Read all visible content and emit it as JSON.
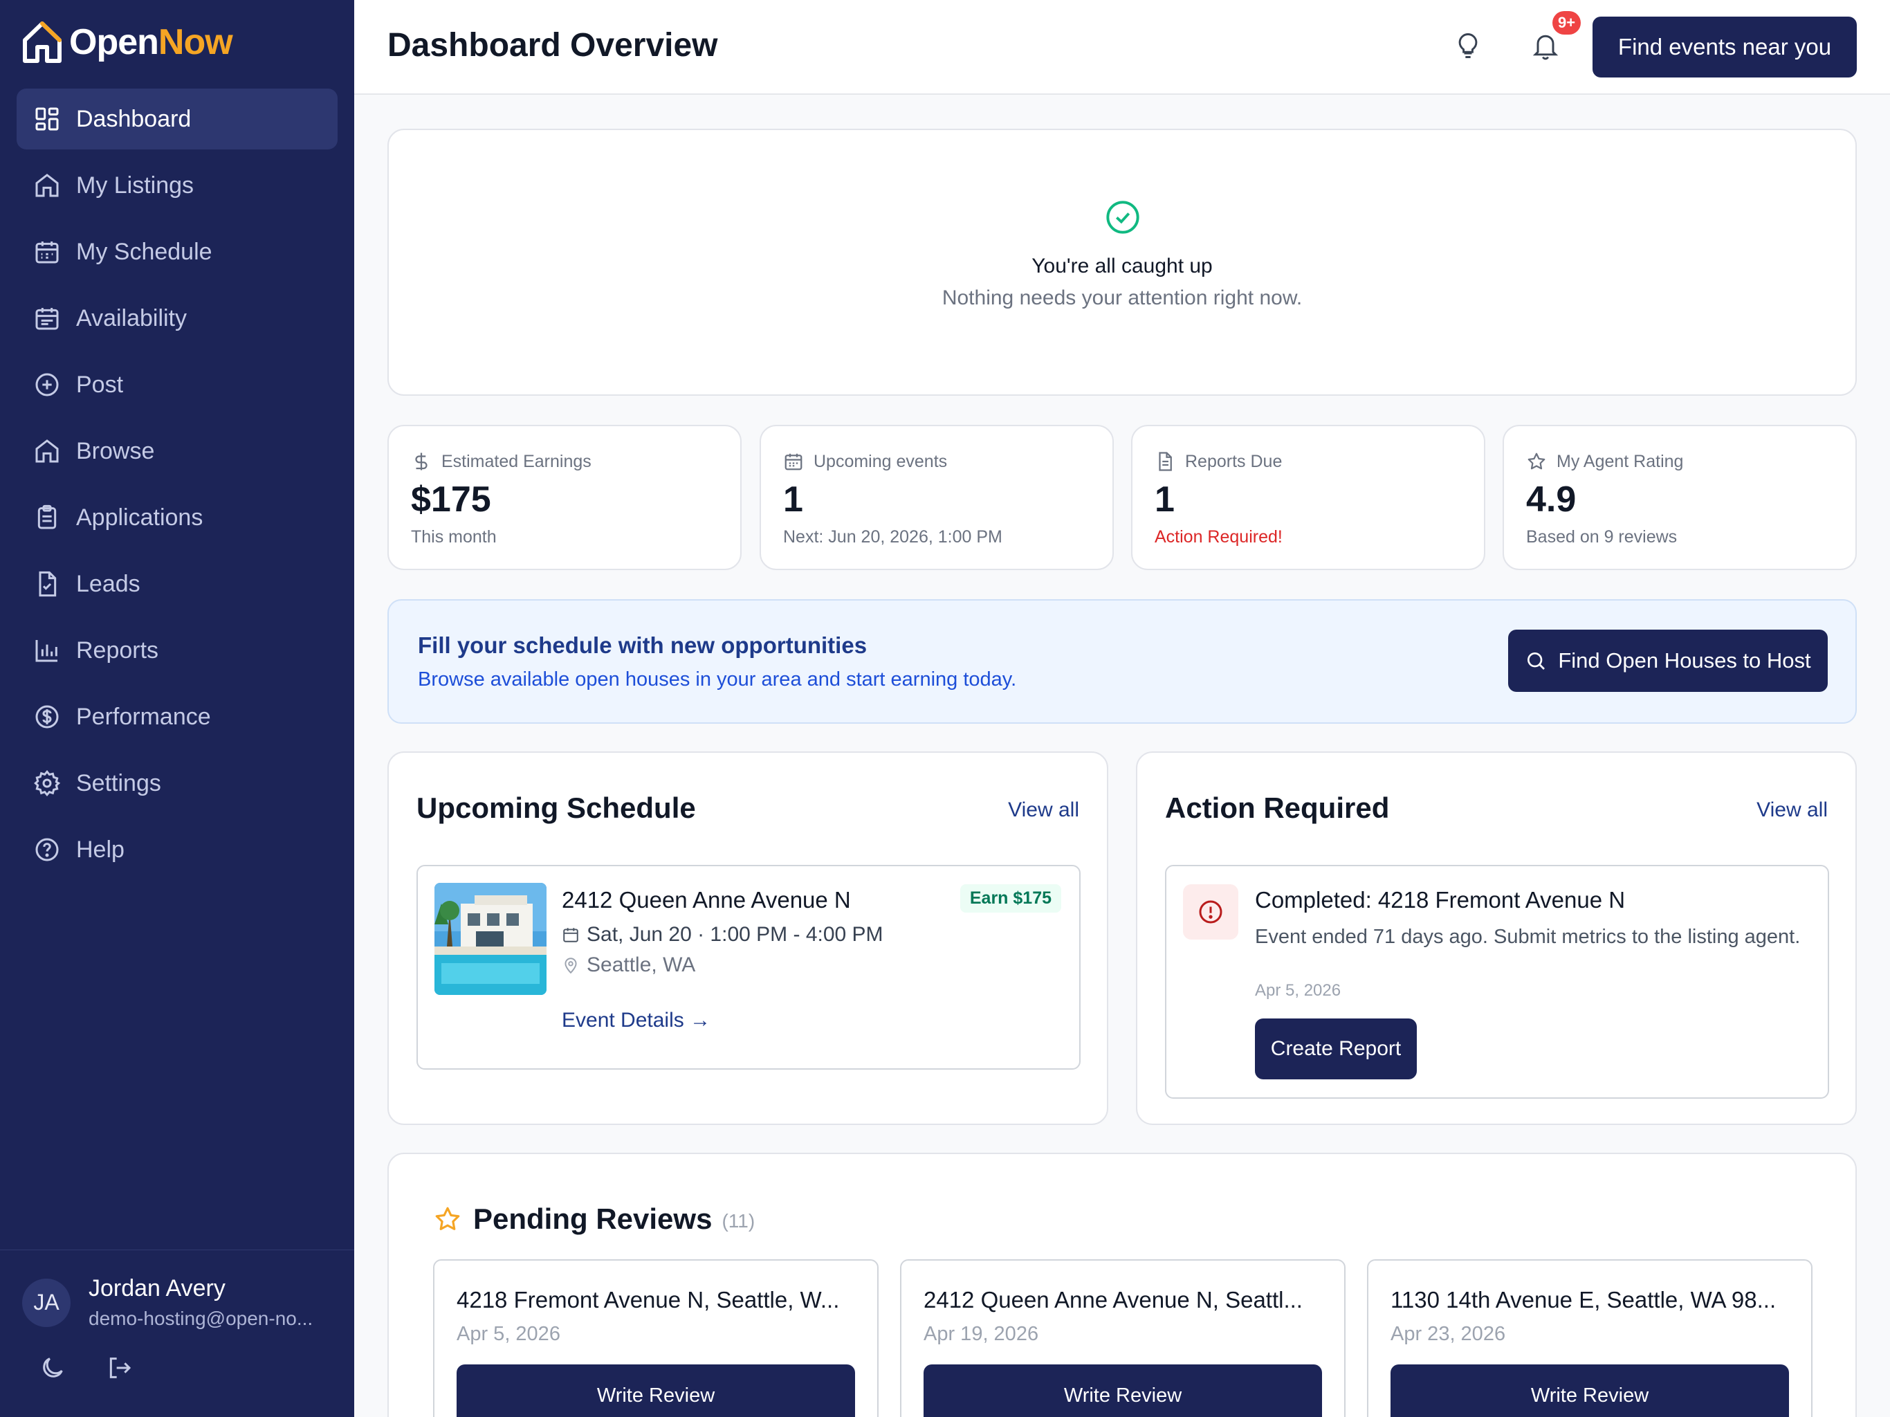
{
  "brand": {
    "open": "Open",
    "now": "Now",
    "accent": "#f5a524",
    "sidebar_bg": "#1c2457"
  },
  "nav": {
    "items": [
      {
        "label": "Dashboard",
        "icon": "grid-icon",
        "active": true
      },
      {
        "label": "My Listings",
        "icon": "home-icon"
      },
      {
        "label": "My Schedule",
        "icon": "calendar-icon"
      },
      {
        "label": "Availability",
        "icon": "calendar-check-icon"
      },
      {
        "label": "Post",
        "icon": "plus-circle-icon"
      },
      {
        "label": "Browse",
        "icon": "home-icon"
      },
      {
        "label": "Applications",
        "icon": "clipboard-icon"
      },
      {
        "label": "Leads",
        "icon": "file-check-icon"
      },
      {
        "label": "Reports",
        "icon": "bar-chart-icon"
      },
      {
        "label": "Performance",
        "icon": "dollar-circle-icon"
      },
      {
        "label": "Settings",
        "icon": "gear-icon"
      },
      {
        "label": "Help",
        "icon": "help-circle-icon"
      }
    ]
  },
  "user": {
    "initials": "JA",
    "name": "Jordan Avery",
    "email": "demo-hosting@open-no..."
  },
  "header": {
    "title": "Dashboard Overview",
    "notification_badge": "9+",
    "find_events_label": "Find events near you"
  },
  "caught_up": {
    "title": "You're all caught up",
    "subtitle": "Nothing needs your attention right now."
  },
  "stats": [
    {
      "label": "Estimated Earnings",
      "value": "$175",
      "sub": "This month",
      "icon": "dollar-icon"
    },
    {
      "label": "Upcoming events",
      "value": "1",
      "sub": "Next: Jun 20, 2026, 1:00 PM",
      "icon": "calendar-icon"
    },
    {
      "label": "Reports Due",
      "value": "1",
      "sub": "Action Required!",
      "icon": "document-icon"
    },
    {
      "label": "My Agent Rating",
      "value": "4.9",
      "sub": "Based on 9 reviews",
      "icon": "star-icon"
    }
  ],
  "promo": {
    "title": "Fill your schedule with new opportunities",
    "subtitle": "Browse available open houses in your area and start earning today.",
    "button": "Find Open Houses to Host"
  },
  "upcoming": {
    "title": "Upcoming Schedule",
    "view_all": "View all",
    "event": {
      "address": "2412 Queen Anne Avenue N",
      "earn": "Earn $175",
      "datetime": "Sat, Jun 20 · 1:00 PM - 4:00 PM",
      "location": "Seattle, WA",
      "link": "Event Details →"
    }
  },
  "action_required": {
    "title": "Action Required",
    "view_all": "View all",
    "item": {
      "title": "Completed: 4218 Fremont Avenue N",
      "description": "Event ended 71 days ago. Submit metrics to the listing agent.",
      "date": "Apr 5, 2026",
      "button": "Create Report"
    }
  },
  "reviews": {
    "title": "Pending Reviews",
    "count": "(11)",
    "items": [
      {
        "address": "4218 Fremont Avenue N, Seattle, W...",
        "date": "Apr 5, 2026",
        "button": "Write Review"
      },
      {
        "address": "2412 Queen Anne Avenue N, Seattl...",
        "date": "Apr 19, 2026",
        "button": "Write Review"
      },
      {
        "address": "1130 14th Avenue E, Seattle, WA 98...",
        "date": "Apr 23, 2026",
        "button": "Write Review"
      }
    ]
  }
}
